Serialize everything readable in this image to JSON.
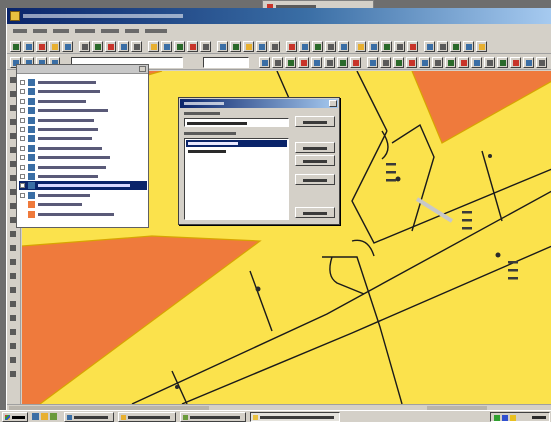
{
  "app": {
    "title": "",
    "accent": "#0a246a"
  },
  "map": {
    "colors": {
      "zone": "#fbe24c",
      "zone_outline": "#d8a400",
      "restricted": "#ef7a3c",
      "line": "#1a1a1a",
      "annotation": "#2a2a2a"
    }
  },
  "layer_tree": {
    "items": [
      {
        "icon": "layer-icon",
        "color": "#3a6ea5",
        "selected": false
      },
      {
        "icon": "layer-icon",
        "color": "#3a6ea5",
        "selected": false
      },
      {
        "icon": "layer-icon",
        "color": "#3a6ea5",
        "selected": false
      },
      {
        "icon": "layer-icon",
        "color": "#3a6ea5",
        "selected": false
      },
      {
        "icon": "layer-icon",
        "color": "#3a6ea5",
        "selected": false
      },
      {
        "icon": "layer-icon",
        "color": "#3a6ea5",
        "selected": false
      },
      {
        "icon": "layer-icon",
        "color": "#3a6ea5",
        "selected": false
      },
      {
        "icon": "layer-icon",
        "color": "#3a6ea5",
        "selected": false
      },
      {
        "icon": "layer-icon",
        "color": "#3a6ea5",
        "selected": false
      },
      {
        "icon": "layer-icon",
        "color": "#3a6ea5",
        "selected": false
      },
      {
        "icon": "layer-icon",
        "color": "#3a6ea5",
        "selected": false
      },
      {
        "icon": "layer-icon",
        "color": "#3a6ea5",
        "selected": true
      },
      {
        "icon": "layer-icon",
        "color": "#3a6ea5",
        "selected": false
      },
      {
        "icon": "polygon-swatch-icon",
        "color": "#ef7a3c",
        "selected": false
      },
      {
        "icon": "polygon-swatch-icon",
        "color": "#ef7a3c",
        "selected": false
      }
    ]
  },
  "dialog": {
    "list_items": [
      {
        "selected": true
      },
      {
        "selected": false
      }
    ],
    "buttons": 5
  },
  "taskbar": {
    "task_buttons": [
      {
        "active": false
      },
      {
        "active": false
      },
      {
        "active": false
      },
      {
        "active": true
      }
    ]
  }
}
